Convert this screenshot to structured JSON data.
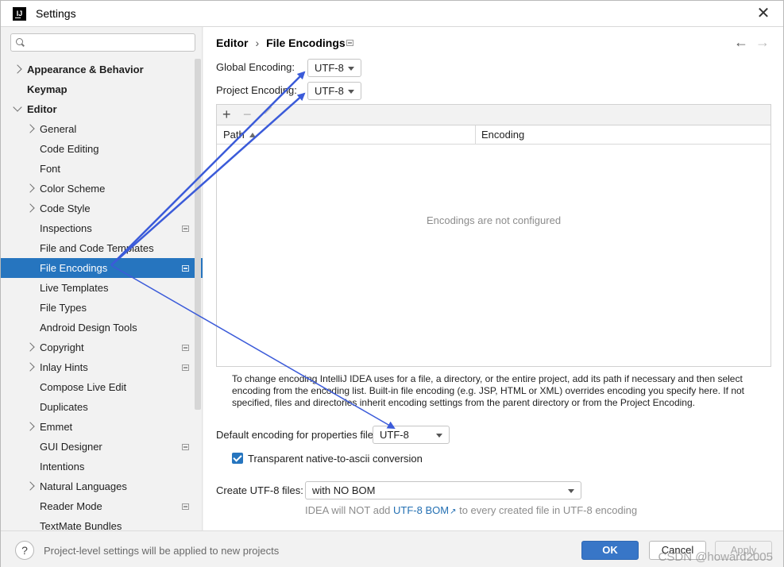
{
  "window": {
    "title": "Settings",
    "app_icon_text": "IJ",
    "close_glyph": "✕"
  },
  "sidebar": {
    "search": {
      "value": "",
      "placeholder": ""
    },
    "items": [
      {
        "label": "Appearance & Behavior",
        "level": 0,
        "expander": "right",
        "project": false
      },
      {
        "label": "Keymap",
        "level": 0,
        "expander": "none",
        "project": false
      },
      {
        "label": "Editor",
        "level": 0,
        "expander": "down",
        "project": false
      },
      {
        "label": "General",
        "level": 1,
        "expander": "right",
        "project": false
      },
      {
        "label": "Code Editing",
        "level": 1,
        "expander": "none",
        "project": false
      },
      {
        "label": "Font",
        "level": 1,
        "expander": "none",
        "project": false
      },
      {
        "label": "Color Scheme",
        "level": 1,
        "expander": "right",
        "project": false
      },
      {
        "label": "Code Style",
        "level": 1,
        "expander": "right",
        "project": false
      },
      {
        "label": "Inspections",
        "level": 1,
        "expander": "none",
        "project": true
      },
      {
        "label": "File and Code Templates",
        "level": 1,
        "expander": "none",
        "project": false
      },
      {
        "label": "File Encodings",
        "level": 1,
        "expander": "none",
        "project": true,
        "selected": true
      },
      {
        "label": "Live Templates",
        "level": 1,
        "expander": "none",
        "project": false
      },
      {
        "label": "File Types",
        "level": 1,
        "expander": "none",
        "project": false
      },
      {
        "label": "Android Design Tools",
        "level": 1,
        "expander": "none",
        "project": false
      },
      {
        "label": "Copyright",
        "level": 1,
        "expander": "right",
        "project": true
      },
      {
        "label": "Inlay Hints",
        "level": 1,
        "expander": "right",
        "project": true
      },
      {
        "label": "Compose Live Edit",
        "level": 1,
        "expander": "none",
        "project": false
      },
      {
        "label": "Duplicates",
        "level": 1,
        "expander": "none",
        "project": false
      },
      {
        "label": "Emmet",
        "level": 1,
        "expander": "right",
        "project": false
      },
      {
        "label": "GUI Designer",
        "level": 1,
        "expander": "none",
        "project": true
      },
      {
        "label": "Intentions",
        "level": 1,
        "expander": "none",
        "project": false
      },
      {
        "label": "Natural Languages",
        "level": 1,
        "expander": "right",
        "project": false
      },
      {
        "label": "Reader Mode",
        "level": 1,
        "expander": "none",
        "project": true
      },
      {
        "label": "TextMate Bundles",
        "level": 1,
        "expander": "none",
        "project": false
      }
    ]
  },
  "content": {
    "breadcrumb": {
      "parent": "Editor",
      "separator": "›",
      "current": "File Encodings"
    },
    "nav": {
      "back": "←",
      "forward": "→"
    },
    "global_encoding": {
      "label": "Global Encoding:",
      "value": "UTF-8"
    },
    "project_encoding": {
      "label": "Project Encoding:",
      "value": "UTF-8"
    },
    "table": {
      "toolbar": {
        "add": "+",
        "remove": "−"
      },
      "columns": [
        "Path",
        "Encoding"
      ],
      "rows": [],
      "empty_text": "Encodings are not configured"
    },
    "help_text": "To change encoding IntelliJ IDEA uses for a file, a directory, or the entire project, add its path if necessary and then select encoding from the encoding list. Built-in file encoding (e.g. JSP, HTML or XML) overrides encoding you specify here. If not specified, files and directories inherit encoding settings from the parent directory or from the Project Encoding.",
    "properties_encoding": {
      "label": "Default encoding for properties files:",
      "value": "UTF-8"
    },
    "native_to_ascii": {
      "label": "Transparent native-to-ascii conversion",
      "checked": true
    },
    "create_utf8": {
      "label": "Create UTF-8 files:",
      "value": "with NO BOM"
    },
    "bom_hint": {
      "prefix": "IDEA will NOT add ",
      "link": "UTF-8 BOM",
      "link_icon": "↗",
      "suffix": " to every created file in UTF-8 encoding"
    }
  },
  "footer": {
    "help": "?",
    "note": "Project-level settings will be applied to new projects",
    "ok": "OK",
    "cancel": "Cancel",
    "apply": "Apply"
  },
  "watermark": "CSDN @howard2005",
  "colors": {
    "accent": "#2675bf",
    "annotation_arrow": "#3b5bd9",
    "ok_button": "#3876c7",
    "link": "#2470b3"
  },
  "icons": {
    "search": "search-icon",
    "close": "close-icon",
    "project_level": "project-level-icon",
    "expander": "chevron-icon",
    "help": "help-icon"
  }
}
